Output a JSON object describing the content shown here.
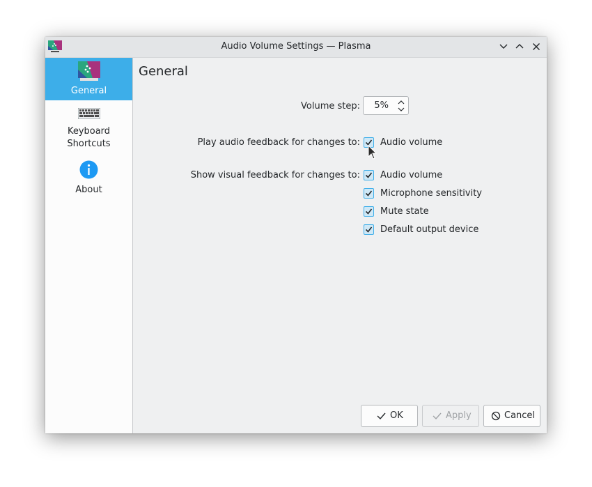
{
  "window": {
    "title": "Audio Volume Settings — Plasma",
    "controls": [
      "minimize-icon",
      "maximize-icon",
      "close-icon"
    ]
  },
  "sidebar": {
    "items": [
      {
        "label": "General",
        "icon": "plasma-general-icon",
        "selected": true
      },
      {
        "label_line1": "Keyboard",
        "label_line2": "Shortcuts",
        "icon": "keyboard-icon",
        "selected": false
      },
      {
        "label": "About",
        "icon": "info-icon",
        "selected": false
      }
    ]
  },
  "page": {
    "title": "General",
    "volume_step": {
      "label": "Volume step:",
      "value": "5%"
    },
    "audio_feedback": {
      "label": "Play audio feedback for changes to:",
      "options": [
        {
          "label": "Audio volume",
          "checked": true
        }
      ]
    },
    "visual_feedback": {
      "label": "Show visual feedback for changes to:",
      "options": [
        {
          "label": "Audio volume",
          "checked": true
        },
        {
          "label": "Microphone sensitivity",
          "checked": true
        },
        {
          "label": "Mute state",
          "checked": true
        },
        {
          "label": "Default output device",
          "checked": true
        }
      ]
    }
  },
  "buttons": {
    "ok": "OK",
    "apply": "Apply",
    "cancel": "Cancel"
  },
  "colors": {
    "accent": "#3daee9",
    "window_bg": "#eff0f1",
    "text": "#232629"
  }
}
